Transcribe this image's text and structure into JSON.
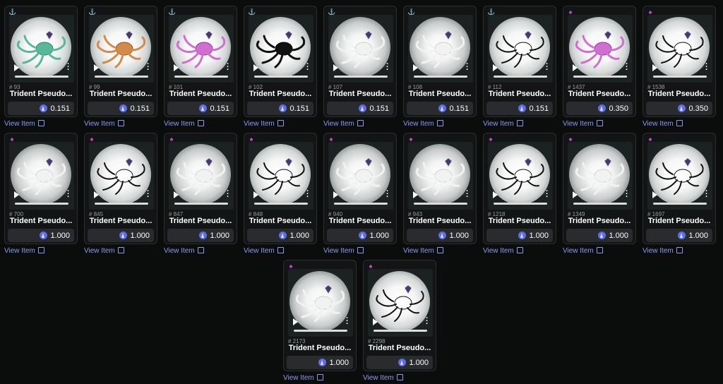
{
  "view_item_label": "View Item",
  "currency_icon": "eth-icon",
  "colors": {
    "accent": "#8c9bf0",
    "eth": "#5d6ee6",
    "card_bg": "#131416",
    "price_bg": "#2a2b2e"
  },
  "cards": [
    {
      "num": "# 93",
      "name": "Trident Pseudo...",
      "price": "0.151",
      "rank": "silver",
      "variant": "teal"
    },
    {
      "num": "# 99",
      "name": "Trident Pseudo...",
      "price": "0.151",
      "rank": "silver",
      "variant": "orange"
    },
    {
      "num": "# 101",
      "name": "Trident Pseudo...",
      "price": "0.151",
      "rank": "silver",
      "variant": "pink"
    },
    {
      "num": "# 102",
      "name": "Trident Pseudo...",
      "price": "0.151",
      "rank": "silver",
      "variant": "black"
    },
    {
      "num": "# 107",
      "name": "Trident Pseudo...",
      "price": "0.151",
      "rank": "silver",
      "variant": "white"
    },
    {
      "num": "# 108",
      "name": "Trident Pseudo...",
      "price": "0.151",
      "rank": "silver",
      "variant": "white"
    },
    {
      "num": "# 112",
      "name": "Trident Pseudo...",
      "price": "0.151",
      "rank": "silver",
      "variant": "outline"
    },
    {
      "num": "# 1437",
      "name": "Trident Pseudo...",
      "price": "0.350",
      "rank": "pink",
      "variant": "pink"
    },
    {
      "num": "# 1538",
      "name": "Trident Pseudo...",
      "price": "0.350",
      "rank": "pink",
      "variant": "outline"
    },
    {
      "num": "# 700",
      "name": "Trident Pseudo...",
      "price": "1.000",
      "rank": "pink",
      "variant": "white"
    },
    {
      "num": "# 845",
      "name": "Trident Pseudo...",
      "price": "1.000",
      "rank": "pink",
      "variant": "outline"
    },
    {
      "num": "# 847",
      "name": "Trident Pseudo...",
      "price": "1.000",
      "rank": "pink",
      "variant": "white"
    },
    {
      "num": "# 848",
      "name": "Trident Pseudo...",
      "price": "1.000",
      "rank": "pink",
      "variant": "outline"
    },
    {
      "num": "# 940",
      "name": "Trident Pseudo...",
      "price": "1.000",
      "rank": "pink",
      "variant": "white"
    },
    {
      "num": "# 943",
      "name": "Trident Pseudo...",
      "price": "1.000",
      "rank": "pink",
      "variant": "white"
    },
    {
      "num": "# 1218",
      "name": "Trident Pseudo...",
      "price": "1.000",
      "rank": "pink",
      "variant": "outline"
    },
    {
      "num": "# 1349",
      "name": "Trident Pseudo...",
      "price": "1.000",
      "rank": "pink",
      "variant": "white"
    },
    {
      "num": "# 1697",
      "name": "Trident Pseudo...",
      "price": "1.000",
      "rank": "pink",
      "variant": "outline"
    },
    {
      "num": "# 2173",
      "name": "Trident Pseudo...",
      "price": "1.000",
      "rank": "pink",
      "variant": "white"
    },
    {
      "num": "# 2298",
      "name": "Trident Pseudo...",
      "price": "1.000",
      "rank": "pink",
      "variant": "outline"
    }
  ]
}
